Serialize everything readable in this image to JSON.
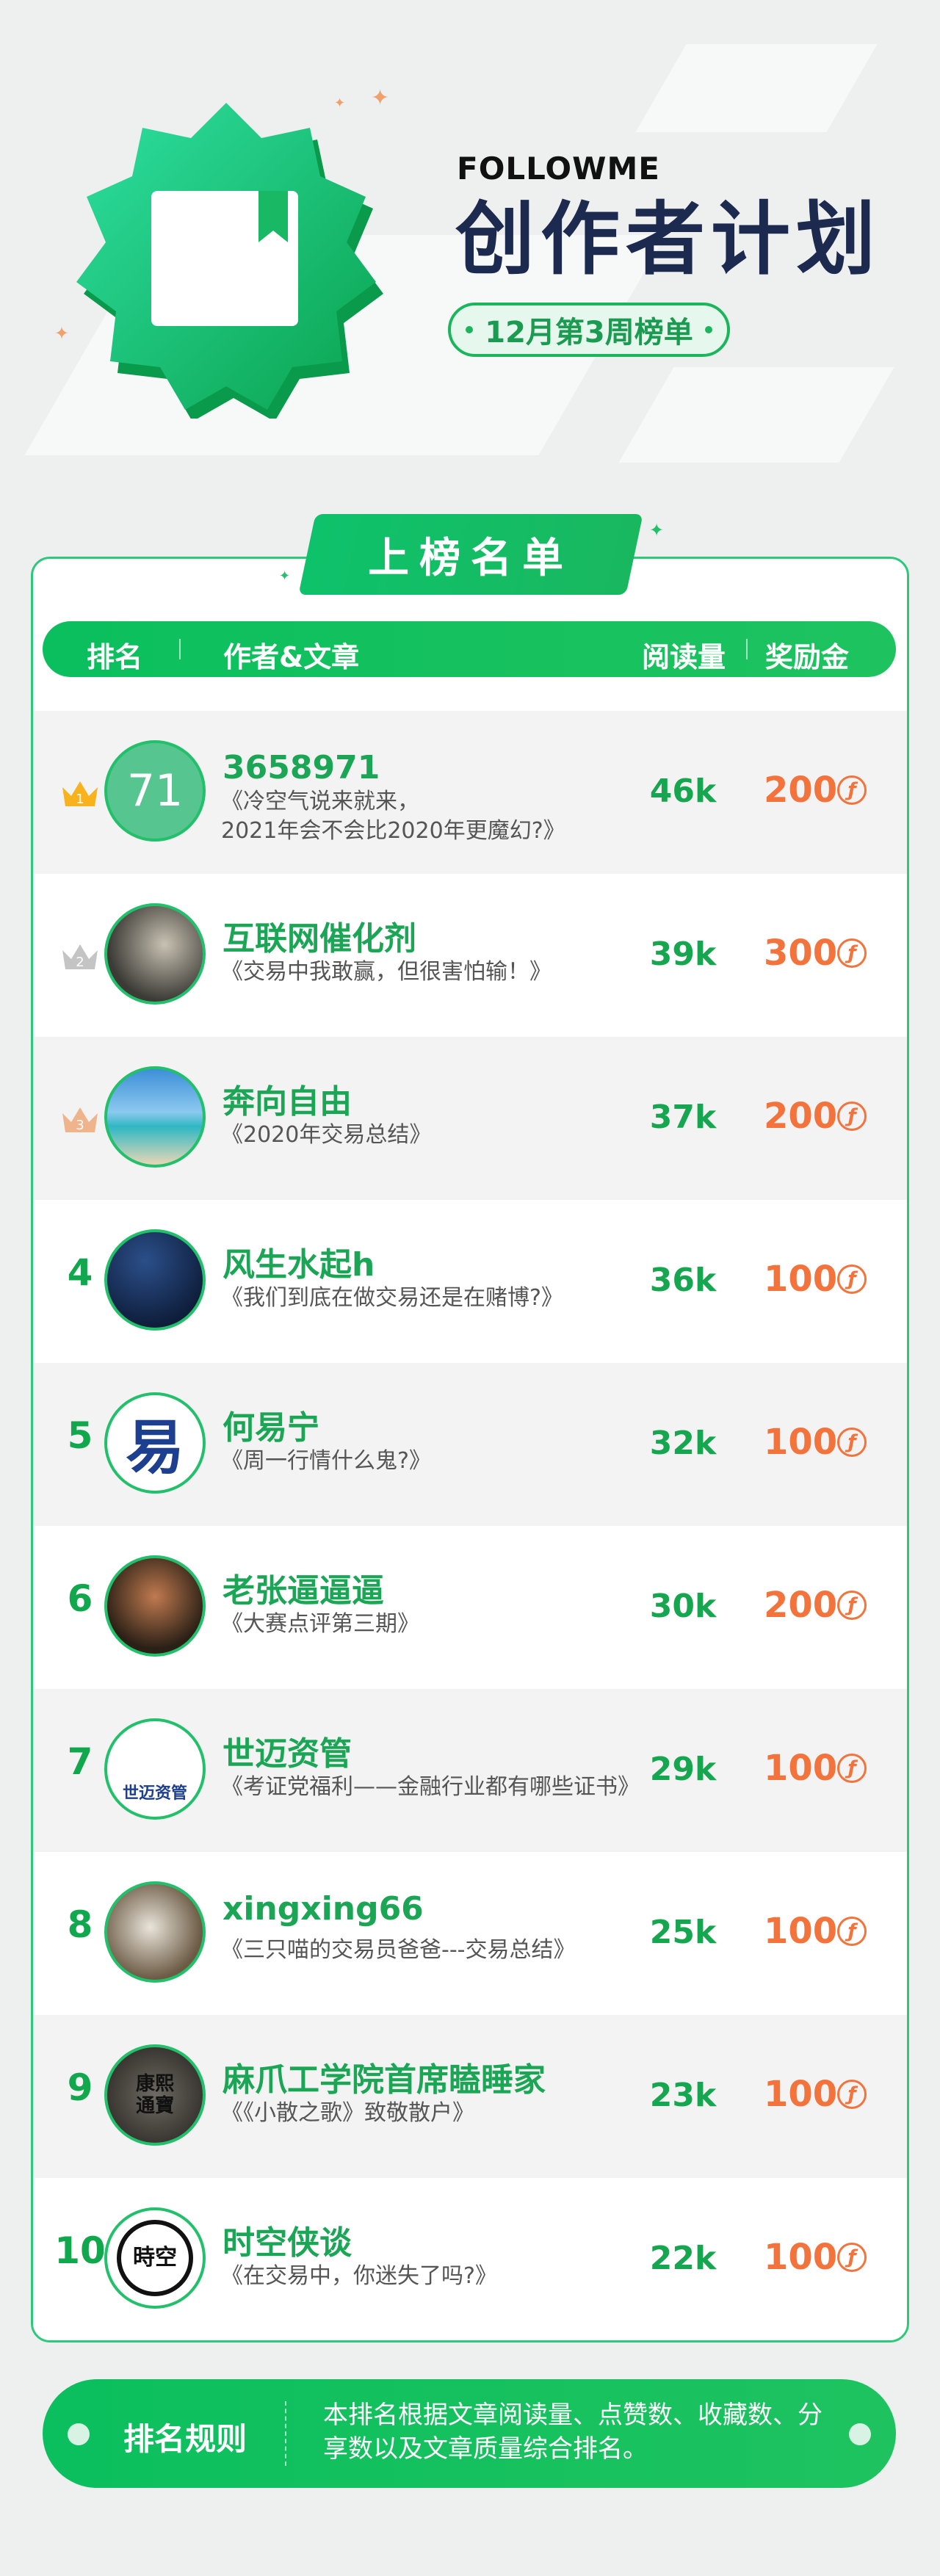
{
  "header": {
    "brand": "FOLLOWME",
    "title": "创作者计划",
    "week_label": "12月第3周榜单"
  },
  "ranking": {
    "ribbon_title": "上榜名单",
    "columns": {
      "rank": "排名",
      "author_article": "作者&文章",
      "reads": "阅读量",
      "bonus": "奖励金"
    },
    "coin_symbol": "ƒ",
    "rows": [
      {
        "rank": "1",
        "medal": "gold",
        "avatar_text": "71",
        "name": "3658971",
        "article": "《冷空气说来就来，\n2021年会不会比2020年更魔幻?》",
        "reads": "46k",
        "bonus": "200"
      },
      {
        "rank": "2",
        "medal": "silver",
        "name": "互联网催化剂",
        "article": "《交易中我敢赢，但很害怕输！》",
        "reads": "39k",
        "bonus": "300"
      },
      {
        "rank": "3",
        "medal": "bronze",
        "name": "奔向自由",
        "article": "《2020年交易总结》",
        "reads": "37k",
        "bonus": "200"
      },
      {
        "rank": "4",
        "name": "风生水起h",
        "article": "《我们到底在做交易还是在赌博?》",
        "reads": "36k",
        "bonus": "100"
      },
      {
        "rank": "5",
        "avatar_text": "易",
        "name": "何易宁",
        "article": "《周一行情什么鬼?》",
        "reads": "32k",
        "bonus": "100"
      },
      {
        "rank": "6",
        "name": "老张逼逼逼",
        "article": "《大赛点评第三期》",
        "reads": "30k",
        "bonus": "200"
      },
      {
        "rank": "7",
        "avatar_text": "世迈资管",
        "name": "世迈资管",
        "article": "《考证党福利——金融行业都有哪些证书》",
        "reads": "29k",
        "bonus": "100"
      },
      {
        "rank": "8",
        "name": "xingxing66",
        "article": "《三只喵的交易员爸爸---交易总结》",
        "reads": "25k",
        "bonus": "100"
      },
      {
        "rank": "9",
        "avatar_text": "康熙通寶",
        "name": "麻爪工学院首席瞌睡家",
        "article": "《《小散之歌》致敬散户》",
        "reads": "23k",
        "bonus": "100"
      },
      {
        "rank": "10",
        "avatar_text": "時空",
        "name": "时空侠谈",
        "article": "《在交易中，你迷失了吗?》",
        "reads": "22k",
        "bonus": "100"
      }
    ]
  },
  "rules": {
    "label": "排名规则",
    "text": "本排名根据文章阅读量、点赞数、收藏数、分享数以及文章质量综合排名。"
  },
  "colors": {
    "accent": "#1bb55c",
    "bonus": "#f2743c",
    "title": "#1c2a4f"
  }
}
